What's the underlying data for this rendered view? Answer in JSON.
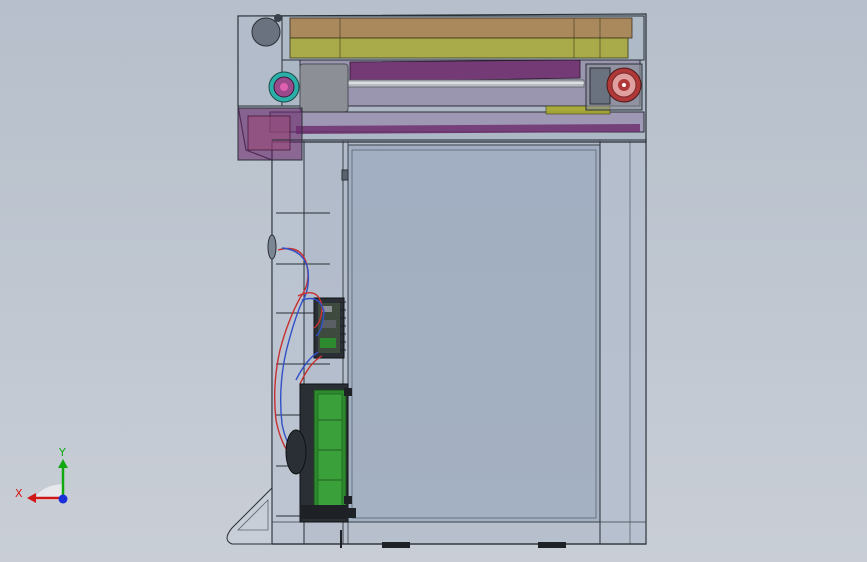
{
  "viewport": {
    "background_top": "#b6bfcb",
    "background_bottom": "#c9ced6"
  },
  "triad": {
    "x_label": "X",
    "y_label": "Y",
    "x_color": "#d01818",
    "y_color": "#12a812",
    "z_color": "#1830d8"
  },
  "model_colors": {
    "housing_edge": "#2a2f36",
    "housing_fill": "#9aa8bb",
    "tray_orange": "#a8783a",
    "tray_yellow": "#a8a82c",
    "roller_purple": "#6c2a6c",
    "gear_red": "#b03838",
    "gear_cyan": "#2ab0a8",
    "pcb_green": "#2e8a2e",
    "wire_red": "#c83030",
    "wire_blue": "#3050c8"
  }
}
